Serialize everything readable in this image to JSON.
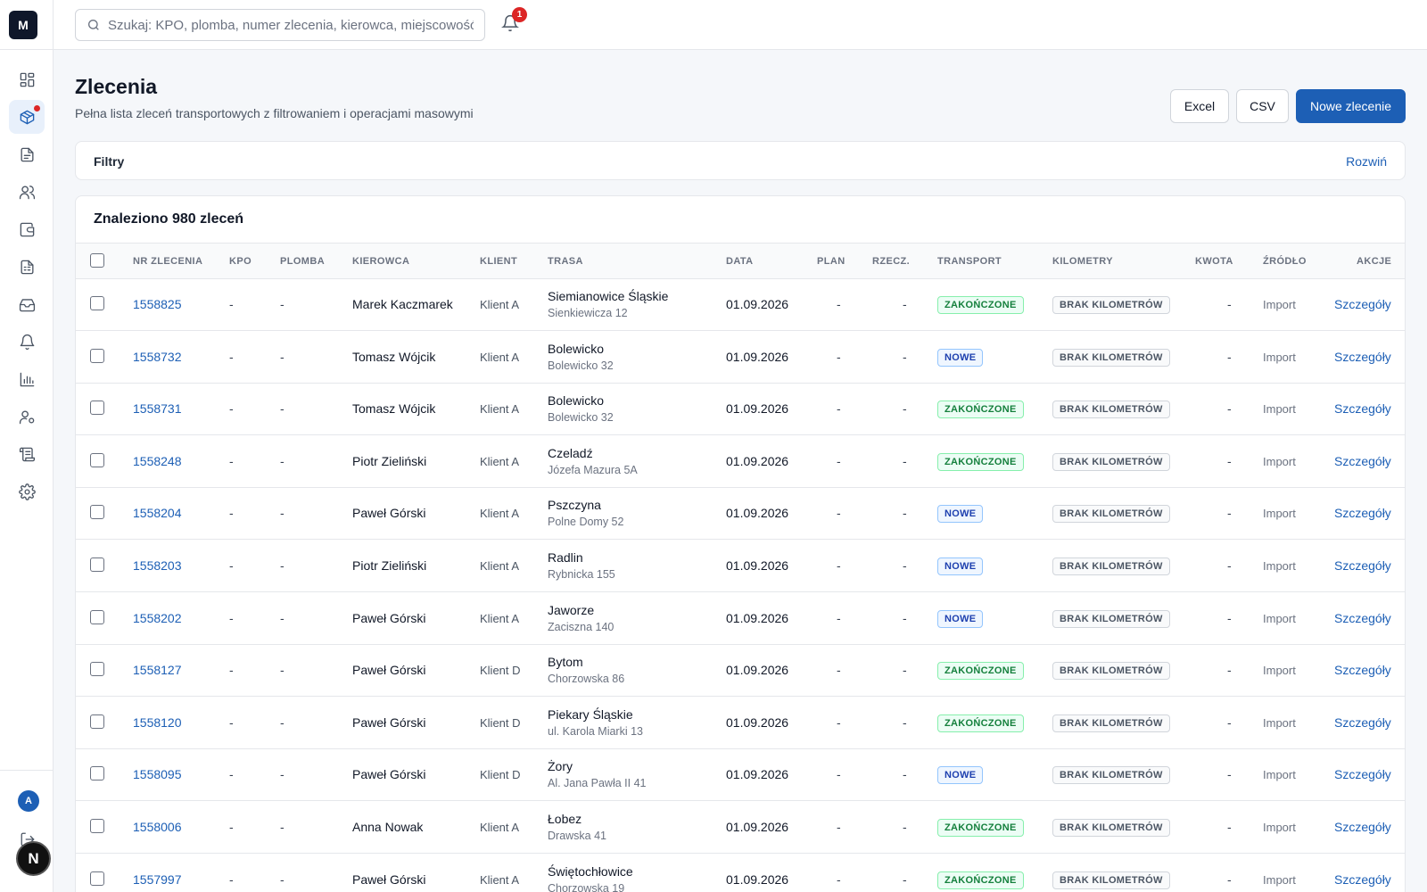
{
  "app": {
    "logo": "M"
  },
  "sidebar": {
    "items": [
      {
        "icon": "dashboard-icon"
      },
      {
        "icon": "package-icon",
        "active": true,
        "dot": true
      },
      {
        "icon": "document-icon"
      },
      {
        "icon": "users-icon"
      },
      {
        "icon": "wallet-icon"
      },
      {
        "icon": "report-icon"
      },
      {
        "icon": "inbox-icon"
      },
      {
        "icon": "bell-icon"
      },
      {
        "icon": "chart-icon"
      },
      {
        "icon": "user-settings-icon"
      },
      {
        "icon": "scroll-icon"
      },
      {
        "icon": "gear-icon"
      }
    ],
    "avatar": "A",
    "logout_icon": "logout-icon",
    "dev_badge": "N"
  },
  "topbar": {
    "search_placeholder": "Szukaj: KPO, plomba, numer zlecenia, kierowca, miejscowość",
    "notifications_count": "1"
  },
  "header": {
    "title": "Zlecenia",
    "subtitle": "Pełna lista zleceń transportowych z filtrowaniem i operacjami masowymi",
    "excel_label": "Excel",
    "csv_label": "CSV",
    "new_label": "Nowe zlecenie"
  },
  "filters": {
    "label": "Filtry",
    "toggle": "Rozwiń"
  },
  "table": {
    "found": "Znaleziono 980 zleceń",
    "columns": [
      "NR ZLECENIA",
      "KPO",
      "PLOMBA",
      "KIEROWCA",
      "KLIENT",
      "TRASA",
      "DATA",
      "PLAN",
      "RZECZ.",
      "TRANSPORT",
      "KILOMETRY",
      "KWOTA",
      "ŹRÓDŁO",
      "AKCJE"
    ],
    "status_colors": {
      "ZAKOŃCZONE": "#15803d",
      "NOWE": "#1e40af"
    },
    "rows": [
      {
        "nr": "1558825",
        "kpo": "-",
        "plomba": "-",
        "driver": "Marek Kaczmarek",
        "client": "Klient A",
        "city": "Siemianowice Śląskie",
        "street": "Sienkiewicza 12",
        "date": "01.09.2026",
        "plan": "-",
        "actual": "-",
        "transport": "ZAKOŃCZONE",
        "km": "BRAK KILOMETRÓW",
        "amount": "-",
        "source": "Import",
        "action": "Szczegóły"
      },
      {
        "nr": "1558732",
        "kpo": "-",
        "plomba": "-",
        "driver": "Tomasz Wójcik",
        "client": "Klient A",
        "city": "Bolewicko",
        "street": "Bolewicko 32",
        "date": "01.09.2026",
        "plan": "-",
        "actual": "-",
        "transport": "NOWE",
        "km": "BRAK KILOMETRÓW",
        "amount": "-",
        "source": "Import",
        "action": "Szczegóły"
      },
      {
        "nr": "1558731",
        "kpo": "-",
        "plomba": "-",
        "driver": "Tomasz Wójcik",
        "client": "Klient A",
        "city": "Bolewicko",
        "street": "Bolewicko 32",
        "date": "01.09.2026",
        "plan": "-",
        "actual": "-",
        "transport": "ZAKOŃCZONE",
        "km": "BRAK KILOMETRÓW",
        "amount": "-",
        "source": "Import",
        "action": "Szczegóły"
      },
      {
        "nr": "1558248",
        "kpo": "-",
        "plomba": "-",
        "driver": "Piotr Zieliński",
        "client": "Klient A",
        "city": "Czeladź",
        "street": "Józefa Mazura 5A",
        "date": "01.09.2026",
        "plan": "-",
        "actual": "-",
        "transport": "ZAKOŃCZONE",
        "km": "BRAK KILOMETRÓW",
        "amount": "-",
        "source": "Import",
        "action": "Szczegóły"
      },
      {
        "nr": "1558204",
        "kpo": "-",
        "plomba": "-",
        "driver": "Paweł Górski",
        "client": "Klient A",
        "city": "Pszczyna",
        "street": "Polne Domy 52",
        "date": "01.09.2026",
        "plan": "-",
        "actual": "-",
        "transport": "NOWE",
        "km": "BRAK KILOMETRÓW",
        "amount": "-",
        "source": "Import",
        "action": "Szczegóły"
      },
      {
        "nr": "1558203",
        "kpo": "-",
        "plomba": "-",
        "driver": "Piotr Zieliński",
        "client": "Klient A",
        "city": "Radlin",
        "street": "Rybnicka 155",
        "date": "01.09.2026",
        "plan": "-",
        "actual": "-",
        "transport": "NOWE",
        "km": "BRAK KILOMETRÓW",
        "amount": "-",
        "source": "Import",
        "action": "Szczegóły"
      },
      {
        "nr": "1558202",
        "kpo": "-",
        "plomba": "-",
        "driver": "Paweł Górski",
        "client": "Klient A",
        "city": "Jaworze",
        "street": "Zaciszna 140",
        "date": "01.09.2026",
        "plan": "-",
        "actual": "-",
        "transport": "NOWE",
        "km": "BRAK KILOMETRÓW",
        "amount": "-",
        "source": "Import",
        "action": "Szczegóły"
      },
      {
        "nr": "1558127",
        "kpo": "-",
        "plomba": "-",
        "driver": "Paweł Górski",
        "client": "Klient D",
        "city": "Bytom",
        "street": "Chorzowska 86",
        "date": "01.09.2026",
        "plan": "-",
        "actual": "-",
        "transport": "ZAKOŃCZONE",
        "km": "BRAK KILOMETRÓW",
        "amount": "-",
        "source": "Import",
        "action": "Szczegóły"
      },
      {
        "nr": "1558120",
        "kpo": "-",
        "plomba": "-",
        "driver": "Paweł Górski",
        "client": "Klient D",
        "city": "Piekary Śląskie",
        "street": "ul. Karola Miarki 13",
        "date": "01.09.2026",
        "plan": "-",
        "actual": "-",
        "transport": "ZAKOŃCZONE",
        "km": "BRAK KILOMETRÓW",
        "amount": "-",
        "source": "Import",
        "action": "Szczegóły"
      },
      {
        "nr": "1558095",
        "kpo": "-",
        "plomba": "-",
        "driver": "Paweł Górski",
        "client": "Klient D",
        "city": "Żory",
        "street": "Al. Jana Pawła II 41",
        "date": "01.09.2026",
        "plan": "-",
        "actual": "-",
        "transport": "NOWE",
        "km": "BRAK KILOMETRÓW",
        "amount": "-",
        "source": "Import",
        "action": "Szczegóły"
      },
      {
        "nr": "1558006",
        "kpo": "-",
        "plomba": "-",
        "driver": "Anna Nowak",
        "client": "Klient A",
        "city": "Łobez",
        "street": "Drawska 41",
        "date": "01.09.2026",
        "plan": "-",
        "actual": "-",
        "transport": "ZAKOŃCZONE",
        "km": "BRAK KILOMETRÓW",
        "amount": "-",
        "source": "Import",
        "action": "Szczegóły"
      },
      {
        "nr": "1557997",
        "kpo": "-",
        "plomba": "-",
        "driver": "Paweł Górski",
        "client": "Klient A",
        "city": "Świętochłowice",
        "street": "Chorzowska 19",
        "date": "01.09.2026",
        "plan": "-",
        "actual": "-",
        "transport": "ZAKOŃCZONE",
        "km": "BRAK KILOMETRÓW",
        "amount": "-",
        "source": "Import",
        "action": "Szczegóły"
      }
    ]
  }
}
